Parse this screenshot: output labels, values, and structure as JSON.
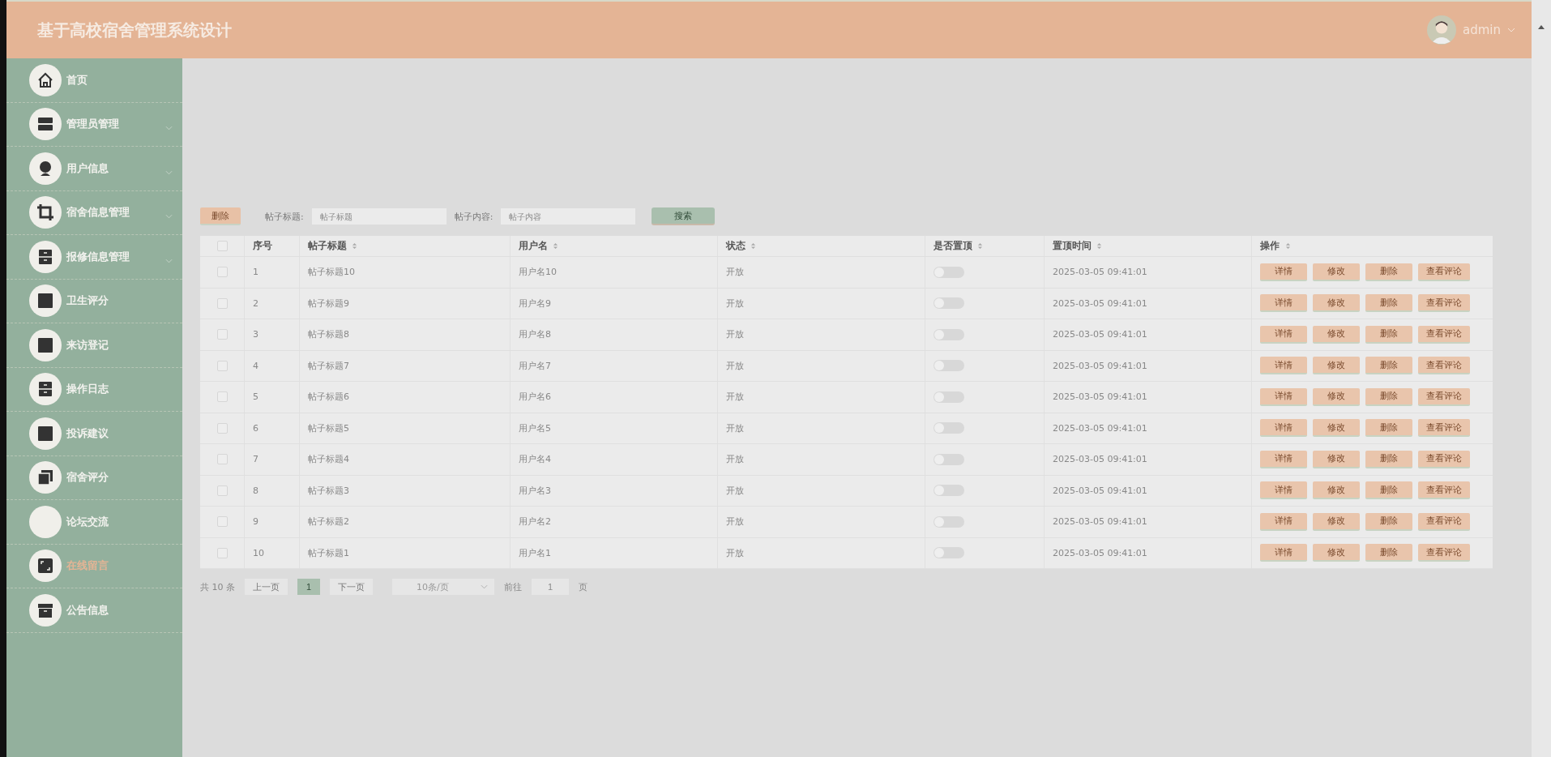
{
  "header": {
    "title": "基于高校宿舍管理系统设计",
    "user": "admin"
  },
  "sidebar": {
    "items": [
      {
        "label": "首页",
        "has_submenu": false,
        "selected": false
      },
      {
        "label": "管理员管理",
        "has_submenu": true,
        "selected": false
      },
      {
        "label": "用户信息",
        "has_submenu": true,
        "selected": false
      },
      {
        "label": "宿舍信息管理",
        "has_submenu": true,
        "selected": false
      },
      {
        "label": "报修信息管理",
        "has_submenu": true,
        "selected": false
      },
      {
        "label": "卫生评分",
        "has_submenu": false,
        "selected": false
      },
      {
        "label": "来访登记",
        "has_submenu": false,
        "selected": false
      },
      {
        "label": "操作日志",
        "has_submenu": false,
        "selected": false
      },
      {
        "label": "投诉建议",
        "has_submenu": false,
        "selected": false
      },
      {
        "label": "宿舍评分",
        "has_submenu": false,
        "selected": false
      },
      {
        "label": "论坛交流",
        "has_submenu": false,
        "selected": false
      },
      {
        "label": "在线留言",
        "has_submenu": false,
        "selected": true
      },
      {
        "label": "公告信息",
        "has_submenu": false,
        "selected": false
      }
    ]
  },
  "toolbar": {
    "delete_button": "删除",
    "fields": [
      {
        "label": "帖子标题:",
        "placeholder": "帖子标题"
      },
      {
        "label": "帖子内容:",
        "placeholder": "帖子内容"
      }
    ],
    "search_button": "搜索"
  },
  "table": {
    "select_all_checked": false,
    "columns": [
      {
        "label": "序号",
        "sortable": false
      },
      {
        "label": "帖子标题",
        "sortable": true
      },
      {
        "label": "用户名",
        "sortable": true
      },
      {
        "label": "状态",
        "sortable": true
      },
      {
        "label": "是否置顶",
        "sortable": true
      },
      {
        "label": "置顶时间",
        "sortable": true
      },
      {
        "label": "操作",
        "sortable": true
      }
    ],
    "rows": [
      {
        "checked": false,
        "index": "1",
        "title": "帖子标题10",
        "user": "用户名10",
        "status": "开放",
        "pinned": false,
        "time": "2025-03-05 09:41:01",
        "actions": [
          "详情",
          "修改",
          "删除",
          "查看评论"
        ]
      },
      {
        "checked": false,
        "index": "2",
        "title": "帖子标题9",
        "user": "用户名9",
        "status": "开放",
        "pinned": false,
        "time": "2025-03-05 09:41:01",
        "actions": [
          "详情",
          "修改",
          "删除",
          "查看评论"
        ]
      },
      {
        "checked": false,
        "index": "3",
        "title": "帖子标题8",
        "user": "用户名8",
        "status": "开放",
        "pinned": false,
        "time": "2025-03-05 09:41:01",
        "actions": [
          "详情",
          "修改",
          "删除",
          "查看评论"
        ]
      },
      {
        "checked": false,
        "index": "4",
        "title": "帖子标题7",
        "user": "用户名7",
        "status": "开放",
        "pinned": false,
        "time": "2025-03-05 09:41:01",
        "actions": [
          "详情",
          "修改",
          "删除",
          "查看评论"
        ]
      },
      {
        "checked": false,
        "index": "5",
        "title": "帖子标题6",
        "user": "用户名6",
        "status": "开放",
        "pinned": false,
        "time": "2025-03-05 09:41:01",
        "actions": [
          "详情",
          "修改",
          "删除",
          "查看评论"
        ]
      },
      {
        "checked": false,
        "index": "6",
        "title": "帖子标题5",
        "user": "用户名5",
        "status": "开放",
        "pinned": false,
        "time": "2025-03-05 09:41:01",
        "actions": [
          "详情",
          "修改",
          "删除",
          "查看评论"
        ]
      },
      {
        "checked": false,
        "index": "7",
        "title": "帖子标题4",
        "user": "用户名4",
        "status": "开放",
        "pinned": false,
        "time": "2025-03-05 09:41:01",
        "actions": [
          "详情",
          "修改",
          "删除",
          "查看评论"
        ]
      },
      {
        "checked": false,
        "index": "8",
        "title": "帖子标题3",
        "user": "用户名3",
        "status": "开放",
        "pinned": false,
        "time": "2025-03-05 09:41:01",
        "actions": [
          "详情",
          "修改",
          "删除",
          "查看评论"
        ]
      },
      {
        "checked": false,
        "index": "9",
        "title": "帖子标题2",
        "user": "用户名2",
        "status": "开放",
        "pinned": false,
        "time": "2025-03-05 09:41:01",
        "actions": [
          "详情",
          "修改",
          "删除",
          "查看评论"
        ]
      },
      {
        "checked": false,
        "index": "10",
        "title": "帖子标题1",
        "user": "用户名1",
        "status": "开放",
        "pinned": false,
        "time": "2025-03-05 09:41:01",
        "actions": [
          "详情",
          "修改",
          "删除",
          "查看评论"
        ]
      }
    ]
  },
  "pagination": {
    "total": "共 10 条",
    "prev": "上一页",
    "pages": [
      {
        "label": "1",
        "selected": true
      }
    ],
    "next": "下一页",
    "page_size": "10条/页",
    "goto_label": "前往",
    "goto_value": "1",
    "goto_suffix": "页"
  }
}
